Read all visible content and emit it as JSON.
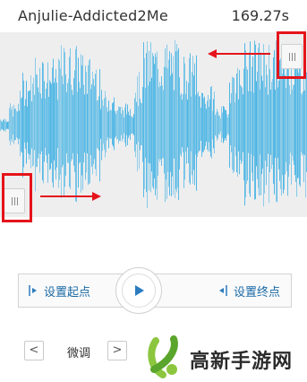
{
  "header": {
    "title": "Anjulie-Addicted2Me",
    "duration": "169.27s"
  },
  "waveform": {
    "color": "#3cb0e4",
    "background": "#eeeeef",
    "marker_color": "#e5141b"
  },
  "controls": {
    "set_start_label": "设置起点",
    "set_end_label": "设置终点",
    "play_icon": "play-icon"
  },
  "fine_tune": {
    "prev_glyph": "<",
    "label": "微调",
    "next_glyph": ">"
  },
  "watermark": {
    "text": "高新手游网"
  }
}
